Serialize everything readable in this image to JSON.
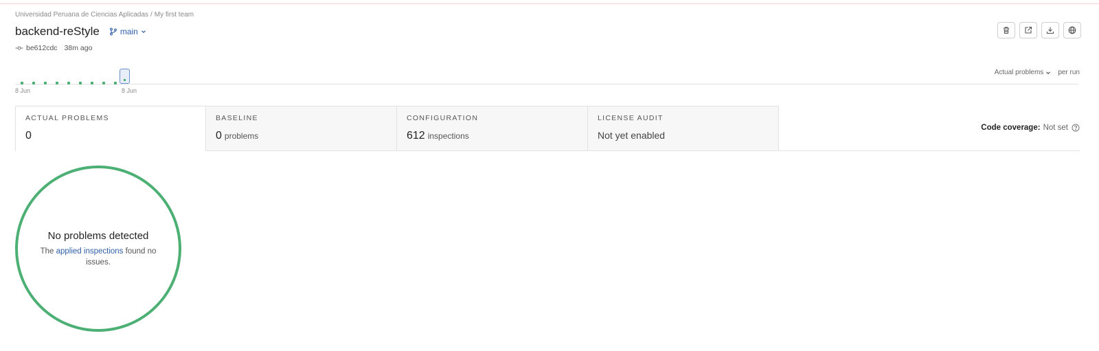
{
  "breadcrumb": {
    "org": "Universidad Peruana de Ciencias Aplicadas",
    "separator": "/",
    "team": "My first team"
  },
  "project": {
    "name": "backend-reStyle",
    "branch": "main"
  },
  "commit": {
    "hash": "be612cdc",
    "time_ago": "38m ago"
  },
  "toolbar": {
    "icons": [
      "trash-icon",
      "external-link-icon",
      "download-icon",
      "globe-icon"
    ]
  },
  "timeline": {
    "start_label": "8 Jun",
    "end_label": "8 Jun",
    "runs": 10,
    "selected_run": 10
  },
  "metric_selector": {
    "value": "Actual problems",
    "suffix": "per run"
  },
  "tabs": [
    {
      "caption": "Actual problems",
      "value": "0",
      "unit": ""
    },
    {
      "caption": "Baseline",
      "value": "0",
      "unit": "problems"
    },
    {
      "caption": "Configuration",
      "value": "612",
      "unit": "inspections"
    },
    {
      "caption": "License audit",
      "value": "Not yet enabled",
      "unit": ""
    }
  ],
  "coverage": {
    "label": "Code coverage:",
    "value": "Not set"
  },
  "empty_state": {
    "title": "No problems detected",
    "text_before": "The",
    "link": "applied inspections",
    "text_after": "found no issues."
  },
  "colors": {
    "accent": "#2f5ea8",
    "success": "#4caf73",
    "border": "#e2e2e2"
  }
}
